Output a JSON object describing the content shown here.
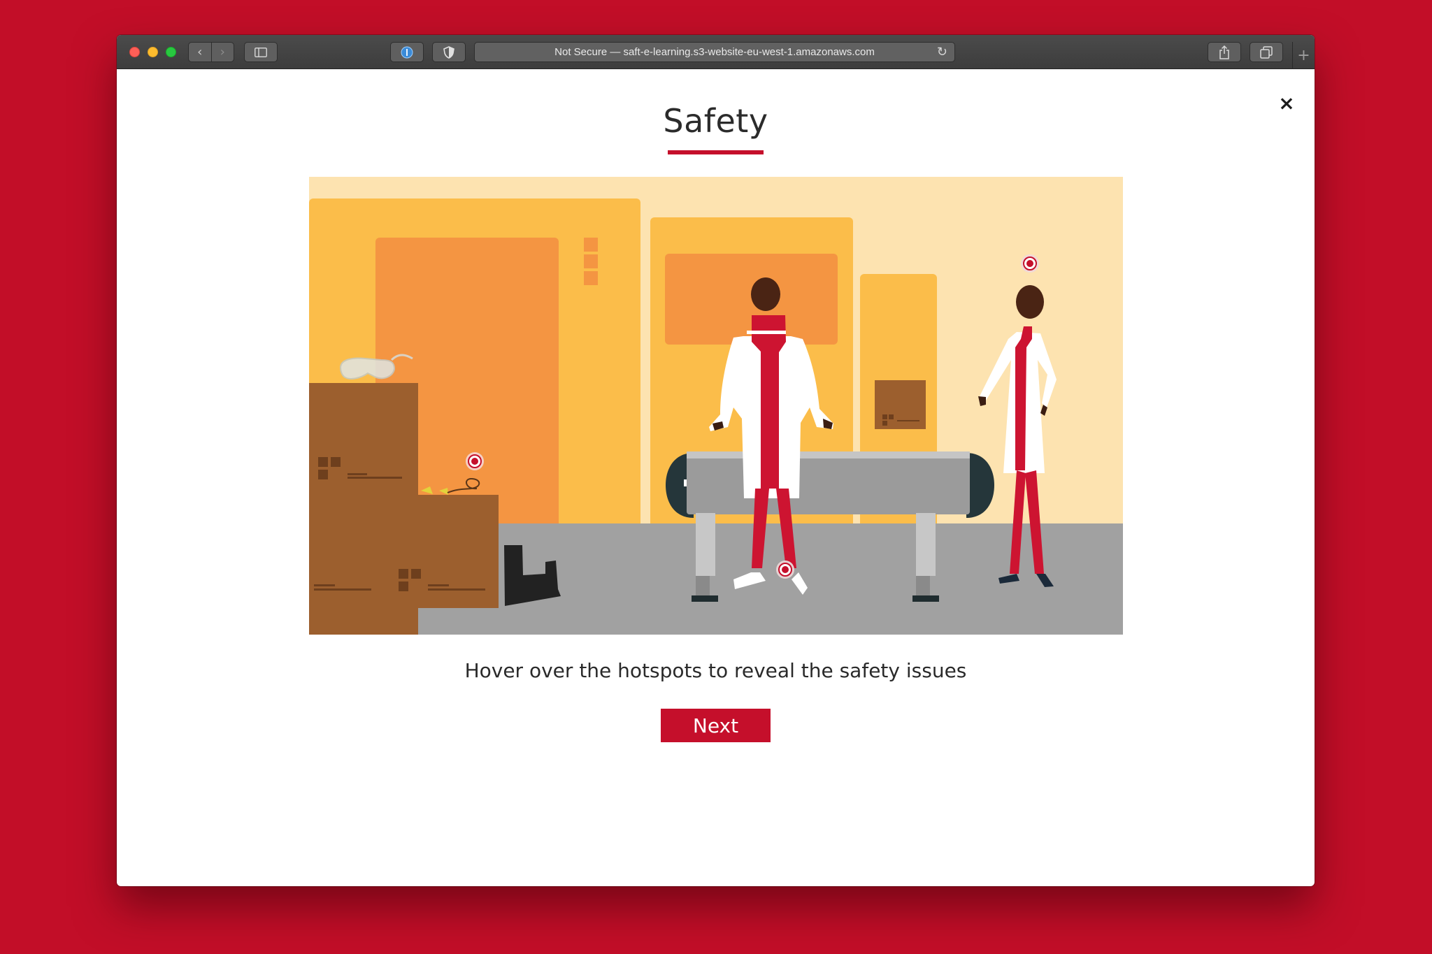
{
  "browser": {
    "address": "Not Secure — saft-e-learning.s3-website-eu-west-1.amazonaws.com",
    "icons": {
      "back": "chevron-left-icon",
      "forward": "chevron-right-icon",
      "sidebar": "sidebar-icon",
      "password": "password-manager-icon",
      "shield": "shield-icon",
      "reload": "reload-icon",
      "share": "share-icon",
      "tabs": "tabs-overview-icon",
      "new_tab": "plus-icon"
    }
  },
  "modal": {
    "close_glyph": "×",
    "title": "Safety",
    "instruction": "Hover over the hotspots to reveal the safety issues",
    "next_label": "Next"
  },
  "illustration": {
    "hotspots": [
      {
        "name": "hotspot-head"
      },
      {
        "name": "hotspot-earplugs"
      },
      {
        "name": "hotspot-shoes"
      }
    ]
  },
  "colors": {
    "brand_red": "#c50f2b",
    "background": "#c20e28",
    "scene_sky": "#fde3b0",
    "scene_floor": "#a0a0a0"
  }
}
